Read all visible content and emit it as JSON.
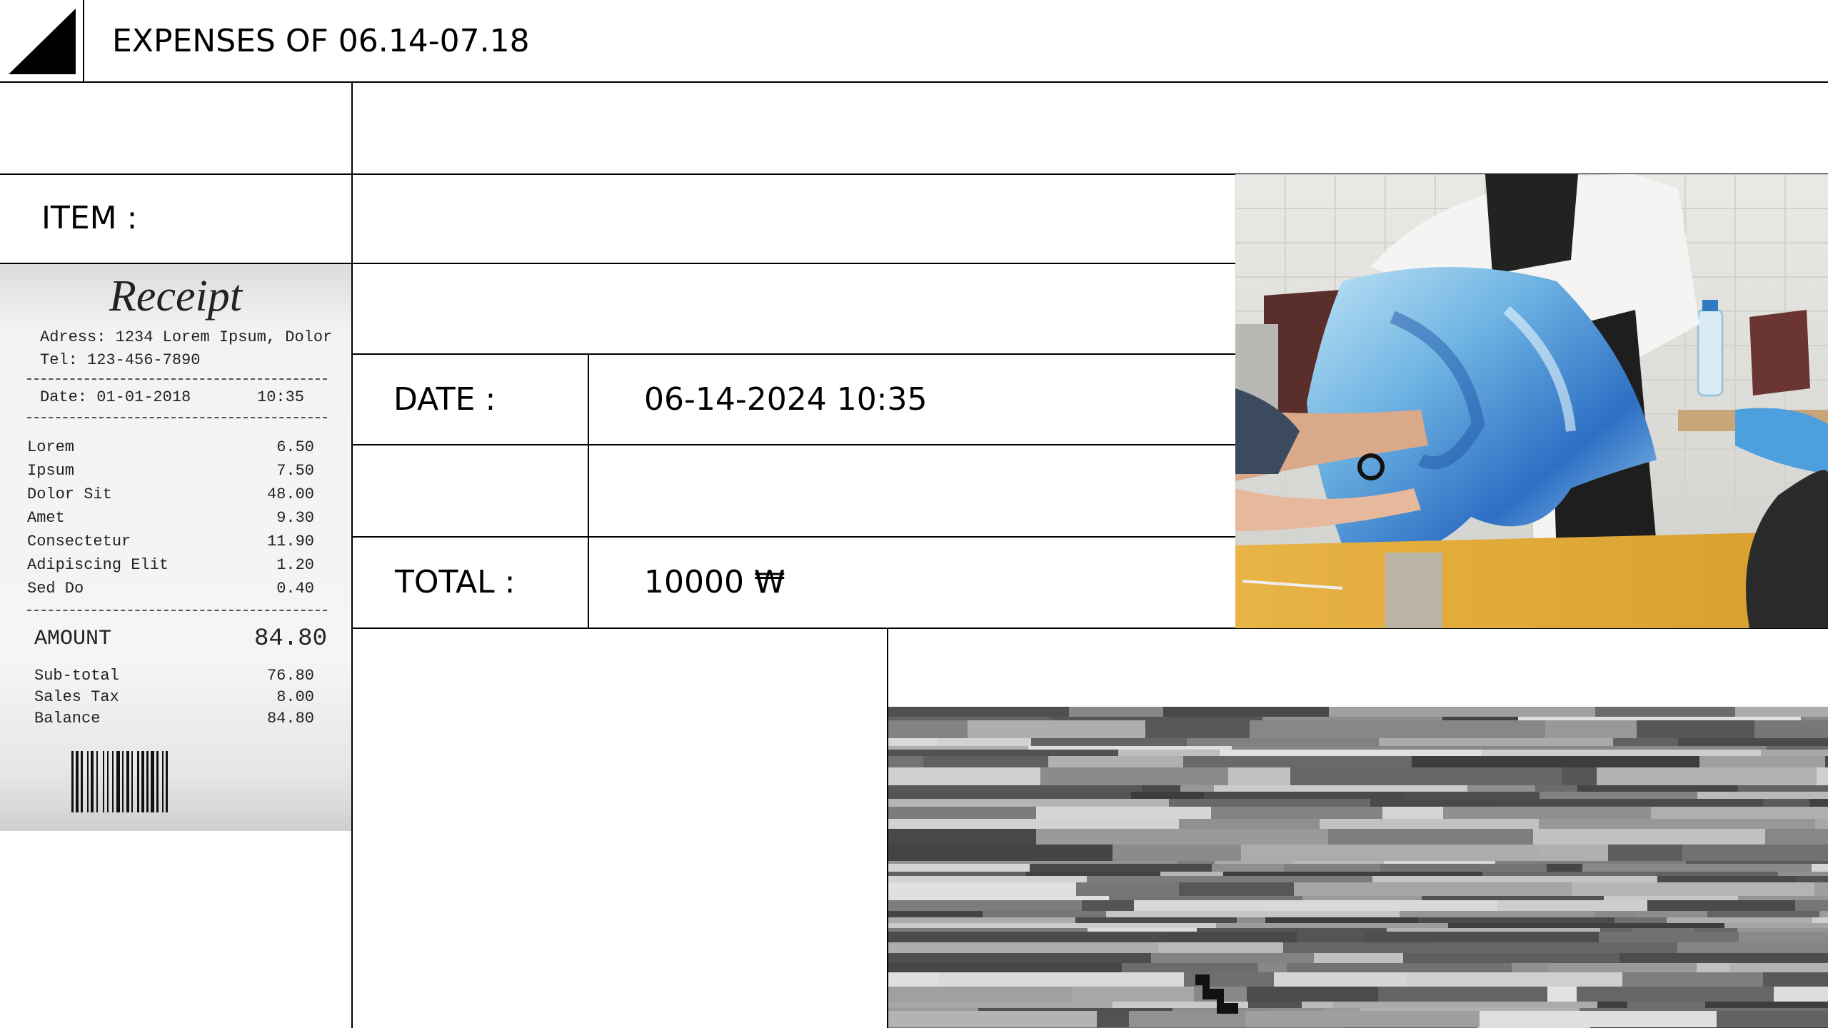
{
  "header": {
    "title": "EXPENSES OF 06.14-07.18"
  },
  "form": {
    "item_label": "ITEM :",
    "date_label": "DATE :",
    "date_value": "06-14-2024 10:35",
    "total_label": "TOTAL :",
    "total_value": "10000 ₩"
  },
  "receipt": {
    "title": "Receipt",
    "address": "Adress: 1234 Lorem Ipsum, Dolor",
    "tel": "Tel: 123-456-7890",
    "date": "Date: 01-01-2018",
    "time": "10:35",
    "items": [
      {
        "name": "Lorem",
        "price": "6.50"
      },
      {
        "name": "Ipsum",
        "price": "7.50"
      },
      {
        "name": "Dolor Sit",
        "price": "48.00"
      },
      {
        "name": "Amet",
        "price": "9.30"
      },
      {
        "name": "Consectetur",
        "price": "11.90"
      },
      {
        "name": "Adipiscing Elit",
        "price": "1.20"
      },
      {
        "name": "Sed Do",
        "price": "0.40"
      }
    ],
    "amount_label": "AMOUNT",
    "amount_value": "84.80",
    "summary": [
      {
        "name": "Sub-total",
        "price": "76.80"
      },
      {
        "name": "Sales Tax",
        "price": "8.00"
      },
      {
        "name": "Balance",
        "price": "84.80"
      }
    ]
  },
  "images": {
    "photo_icon": "photo-of-fabric-work",
    "glitch_icon": "glitch-texture"
  }
}
